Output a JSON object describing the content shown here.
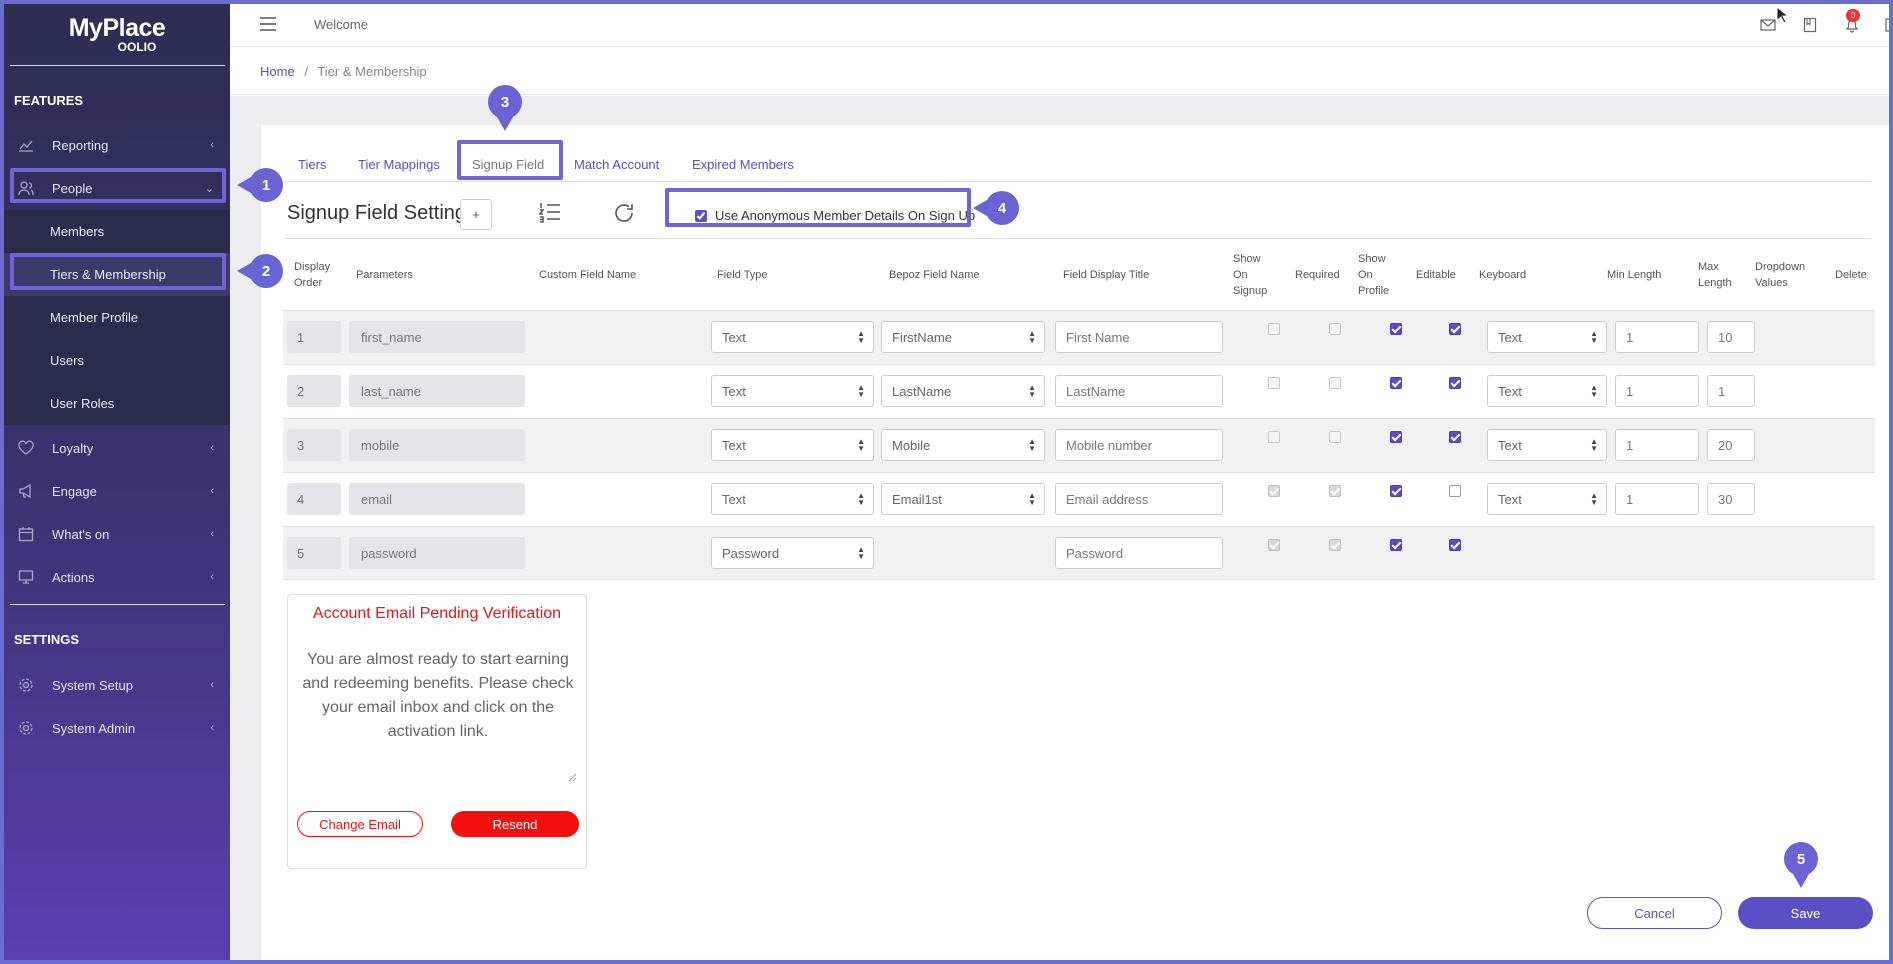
{
  "app": {
    "logo_main": "MyPlace",
    "logo_sub": "OOLIO"
  },
  "sidebar": {
    "features_title": "FEATURES",
    "settings_title": "SETTINGS",
    "items": [
      {
        "label": "Reporting",
        "icon": "chart-line-icon"
      },
      {
        "label": "People",
        "icon": "people-icon"
      },
      {
        "label": "Loyalty",
        "icon": "heart-icon"
      },
      {
        "label": "Engage",
        "icon": "megaphone-icon"
      },
      {
        "label": "What's on",
        "icon": "calendar-icon"
      },
      {
        "label": "Actions",
        "icon": "monitor-icon"
      }
    ],
    "people_subitems": [
      "Members",
      "Tiers & Membership",
      "Member Profile",
      "Users",
      "User Roles"
    ],
    "settings_items": [
      {
        "label": "System Setup",
        "icon": "gear-icon"
      },
      {
        "label": "System Admin",
        "icon": "gear-icon"
      }
    ]
  },
  "topbar": {
    "welcome": "Welcome",
    "notification_count": "0"
  },
  "breadcrumb": {
    "home": "Home",
    "separator": "/",
    "current": "Tier & Membership"
  },
  "tabs": [
    "Tiers",
    "Tier Mappings",
    "Signup Field",
    "Match Account",
    "Expired Members"
  ],
  "active_tab": "Signup Field",
  "section": {
    "title": "Signup Field Setting",
    "add_label": "+",
    "anonymous_label": "Use Anonymous Member Details On Sign Up"
  },
  "columns": {
    "display_order": [
      "Display",
      "Order"
    ],
    "parameters": "Parameters",
    "custom_field_name": "Custom Field Name",
    "field_type": "Field Type",
    "bepoz_field_name": "Bepoz Field Name",
    "field_display_title": "Field Display Title",
    "show_on_signup": [
      "Show",
      "On",
      "Signup"
    ],
    "required": "Required",
    "show_on_profile": [
      "Show",
      "On",
      "Profile"
    ],
    "editable": "Editable",
    "keyboard": "Keyboard",
    "min_length": "Min Length",
    "max_length": [
      "Max",
      "Length"
    ],
    "dropdown_values": [
      "Dropdown",
      "Values"
    ],
    "delete": "Delete"
  },
  "rows": [
    {
      "order": "1",
      "param": "first_name",
      "field_type": "Text",
      "bepoz": "FirstName",
      "title": "First Name",
      "keyboard": "Text",
      "min": "1",
      "max": "10"
    },
    {
      "order": "2",
      "param": "last_name",
      "field_type": "Text",
      "bepoz": "LastName",
      "title": "LastName",
      "keyboard": "Text",
      "min": "1",
      "max": "1"
    },
    {
      "order": "3",
      "param": "mobile",
      "field_type": "Text",
      "bepoz": "Mobile",
      "title": "Mobile number",
      "keyboard": "Text",
      "min": "1",
      "max": "20"
    },
    {
      "order": "4",
      "param": "email",
      "field_type": "Text",
      "bepoz": "Email1st",
      "title": "Email address",
      "keyboard": "Text",
      "min": "1",
      "max": "30"
    },
    {
      "order": "5",
      "param": "password",
      "field_type": "Password",
      "title": "Password"
    }
  ],
  "preview": {
    "title": "Account Email Pending Verification",
    "body": "You are almost ready to start earning and redeeming benefits. Please check your email inbox and click on the activation link.",
    "change_email": "Change Email",
    "resend": "Resend"
  },
  "actions": {
    "cancel": "Cancel",
    "save": "Save"
  },
  "markers": [
    "1",
    "2",
    "3",
    "4",
    "5"
  ],
  "colors": {
    "accent": "#5b4fc6",
    "highlight": "#6f64d6",
    "danger": "#e8141c"
  }
}
